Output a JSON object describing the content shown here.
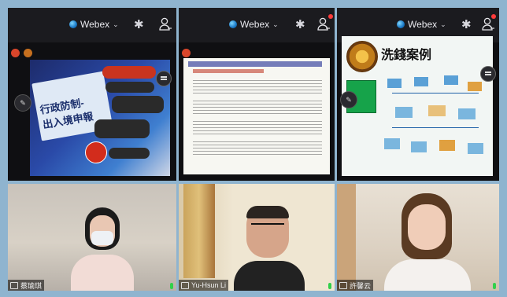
{
  "app": {
    "name": "Webex",
    "accent": "#1a79c7"
  },
  "panels": [
    {
      "slide": {
        "title": "行政防制-\n出入境申報",
        "bubbles": [
          "",
          "",
          "",
          "",
          ""
        ],
        "badge": ""
      }
    },
    {
      "slide": {
        "header": "",
        "subheader": "",
        "bullets": [
          "",
          "",
          "",
          ""
        ]
      }
    },
    {
      "slide": {
        "title": "洗錢案例",
        "sidebar_label": ""
      }
    }
  ],
  "videos": [
    {
      "name": "蔡瑜琪"
    },
    {
      "name": "Yu-Hsun Li"
    },
    {
      "name": "許馨云"
    }
  ]
}
